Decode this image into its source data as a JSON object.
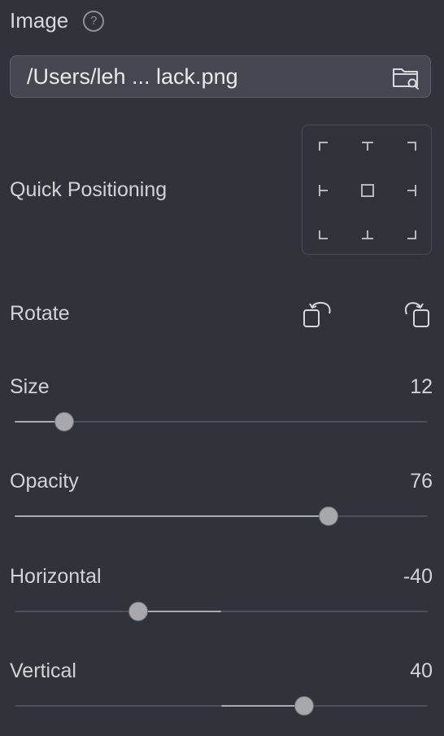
{
  "image_section": {
    "title": "Image",
    "help_icon": "?",
    "path_value": "/Users/leh ... lack.png",
    "browse_icon": "folder-search-icon"
  },
  "quick_positioning": {
    "label": "Quick Positioning",
    "positions": [
      "top-left",
      "top-center",
      "top-right",
      "middle-left",
      "center",
      "middle-right",
      "bottom-left",
      "bottom-center",
      "bottom-right"
    ]
  },
  "rotate": {
    "label": "Rotate",
    "left_icon": "rotate-left-icon",
    "right_icon": "rotate-right-icon"
  },
  "sliders": {
    "size": {
      "label": "Size",
      "value": "12",
      "min": 0,
      "max": 100,
      "level": 12,
      "fill_from": 0
    },
    "opacity": {
      "label": "Opacity",
      "value": "76",
      "min": 0,
      "max": 100,
      "level": 76,
      "fill_from": 0
    },
    "horizontal": {
      "label": "Horizontal",
      "value": "-40",
      "min": -100,
      "max": 100,
      "level": -40,
      "fill_from": 0
    },
    "vertical": {
      "label": "Vertical",
      "value": "40",
      "min": -100,
      "max": 100,
      "level": 40,
      "fill_from": 0
    }
  },
  "colors": {
    "background": "#30333a",
    "field": "#454850",
    "track": "#4d5058",
    "track_fill": "#a9abb0",
    "thumb": "#a7a8ab"
  }
}
